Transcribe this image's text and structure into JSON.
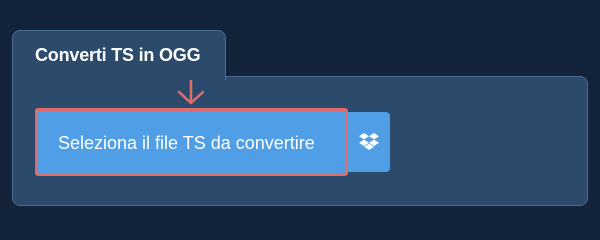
{
  "panel": {
    "tab_title": "Converti TS in OGG"
  },
  "buttons": {
    "select_file_label": "Seleziona il file TS da convertire",
    "dropbox_icon": "dropbox-icon"
  },
  "colors": {
    "page_background": "#13233a",
    "panel_background": "#2c4a6b",
    "button_blue": "#4f9ee6",
    "highlight_red": "#e06c6c"
  },
  "icons": {
    "arrow": "arrow-down-icon",
    "dropbox": "dropbox-icon"
  }
}
